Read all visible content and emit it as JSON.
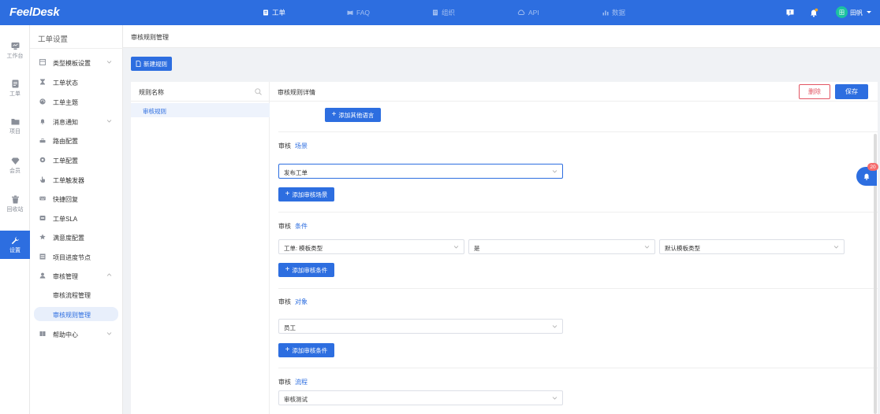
{
  "app": {
    "logo": "FeelDesk"
  },
  "topnav": {
    "items": [
      {
        "label": "工单",
        "icon": "ticket-icon",
        "active": true
      },
      {
        "label": "FAQ",
        "icon": "book-icon",
        "active": false
      },
      {
        "label": "组织",
        "icon": "building-icon",
        "active": false
      },
      {
        "label": "API",
        "icon": "cloud-icon",
        "active": false
      },
      {
        "label": "数据",
        "icon": "chart-icon",
        "active": false
      }
    ],
    "user": {
      "avatar_text": "田",
      "name": "田帆"
    }
  },
  "rail": {
    "items": [
      {
        "label": "工作台",
        "icon": "dashboard-icon",
        "active": false
      },
      {
        "label": "工单",
        "icon": "document-icon",
        "active": false
      },
      {
        "label": "项目",
        "icon": "folder-icon",
        "active": false
      },
      {
        "label": "会员",
        "icon": "diamond-icon",
        "active": false
      },
      {
        "label": "回收站",
        "icon": "trash-icon",
        "active": false
      },
      {
        "label": "设置",
        "icon": "wrench-icon",
        "active": true
      }
    ]
  },
  "sidebar": {
    "title": "工单设置",
    "items": [
      {
        "label": "类型模板设置",
        "icon": "template-icon",
        "chevron": "down"
      },
      {
        "label": "工单状态",
        "icon": "hourglass-icon"
      },
      {
        "label": "工单主题",
        "icon": "palette-icon"
      },
      {
        "label": "消息通知",
        "icon": "bell-icon",
        "chevron": "down"
      },
      {
        "label": "路由配置",
        "icon": "router-icon"
      },
      {
        "label": "工单配置",
        "icon": "settings-icon"
      },
      {
        "label": "工单触发器",
        "icon": "pointer-icon"
      },
      {
        "label": "快捷回复",
        "icon": "keyboard-icon"
      },
      {
        "label": "工单SLA",
        "icon": "shield-icon"
      },
      {
        "label": "满意度配置",
        "icon": "star-icon"
      },
      {
        "label": "项目进度节点",
        "icon": "list-icon"
      },
      {
        "label": "审核管理",
        "icon": "user-icon",
        "chevron": "up"
      }
    ],
    "subitems": [
      {
        "label": "审核流程管理",
        "active": false
      },
      {
        "label": "审核规则管理",
        "active": true
      }
    ],
    "last_item": {
      "label": "帮助中心",
      "icon": "help-book-icon",
      "chevron": "down"
    }
  },
  "page": {
    "title": "审核规则管理",
    "new_rule_label": "新建规则"
  },
  "rule_list": {
    "header": "规则名称",
    "items": [
      "审核规则"
    ]
  },
  "detail": {
    "header": "审核规则详情",
    "delete_label": "删除",
    "save_label": "保存",
    "add_language_label": "添加其他语言",
    "scene": {
      "label": "审核",
      "accent": "场景",
      "select_value": "发布工单",
      "add_label": "添加审核场景"
    },
    "condition": {
      "label": "审核",
      "accent": "条件",
      "field_value": "工单: 模板类型",
      "operator_value": "是",
      "target_value": "默认模板类型",
      "add_label": "添加审核条件"
    },
    "target": {
      "label": "审核",
      "accent": "对象",
      "select_value": "员工",
      "add_label": "添加审核条件"
    },
    "flow": {
      "label": "审核",
      "accent": "流程",
      "select_value": "审核测试"
    }
  },
  "notifications": {
    "count": "20"
  }
}
